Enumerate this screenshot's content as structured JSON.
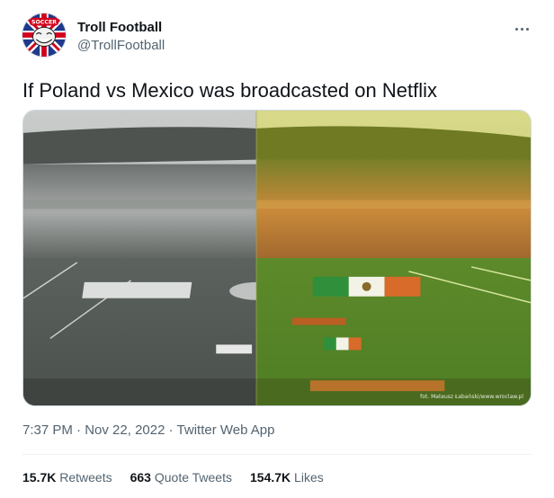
{
  "author": {
    "display_name": "Troll Football",
    "handle": "@TrollFootball",
    "avatar_badge_text": "SOCCER",
    "avatar_icon": "troll-face-union-jack-icon"
  },
  "more_icon": "more-dots-icon",
  "tweet": {
    "text": "If Poland vs Mexico was broadcasted on Netflix",
    "media_alt_credit": "fot. Mateusz Łabański/www.wroclaw.pl"
  },
  "meta": {
    "time": "7:37 PM",
    "separator": "·",
    "date": "Nov 22, 2022",
    "source": "Twitter Web App"
  },
  "stats": {
    "retweets_count": "15.7K",
    "retweets_label": "Retweets",
    "quotes_count": "663",
    "quotes_label": "Quote Tweets",
    "likes_count": "154.7K",
    "likes_label": "Likes"
  },
  "colors": {
    "text_primary": "#0f1419",
    "text_secondary": "#536471",
    "poland_tint": "#7a7f7c",
    "mexico_tint": "#9aa833"
  }
}
